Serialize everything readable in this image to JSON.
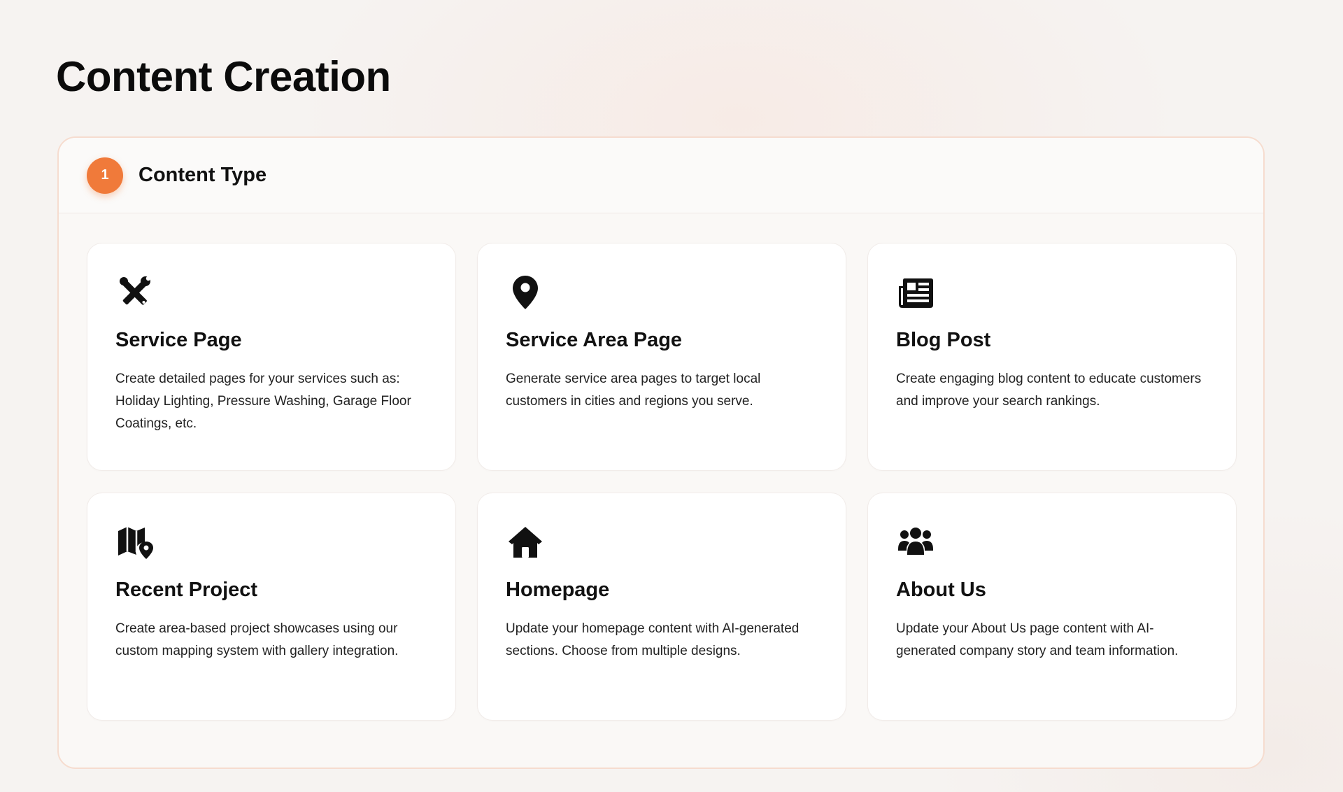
{
  "page": {
    "title": "Content Creation"
  },
  "step": {
    "number": "1",
    "title": "Content Type"
  },
  "colors": {
    "accent": "#f07a3a",
    "panel_border": "#f6dccf"
  },
  "cards": [
    {
      "icon": "tools-icon",
      "title": "Service Page",
      "description": "Create detailed pages for your services such as: Holiday Lighting, Pressure Washing, Garage Floor Coatings, etc."
    },
    {
      "icon": "map-pin-icon",
      "title": "Service Area Page",
      "description": "Generate service area pages to target local customers in cities and regions you serve."
    },
    {
      "icon": "newspaper-icon",
      "title": "Blog Post",
      "description": "Create engaging blog content to educate customers and improve your search rankings."
    },
    {
      "icon": "map-location-icon",
      "title": "Recent Project",
      "description": "Create area-based project showcases using our custom mapping system with gallery integration."
    },
    {
      "icon": "home-icon",
      "title": "Homepage",
      "description": "Update your homepage content with AI-generated sections. Choose from multiple designs."
    },
    {
      "icon": "users-icon",
      "title": "About Us",
      "description": "Update your About Us page content with AI-generated company story and team information."
    }
  ]
}
